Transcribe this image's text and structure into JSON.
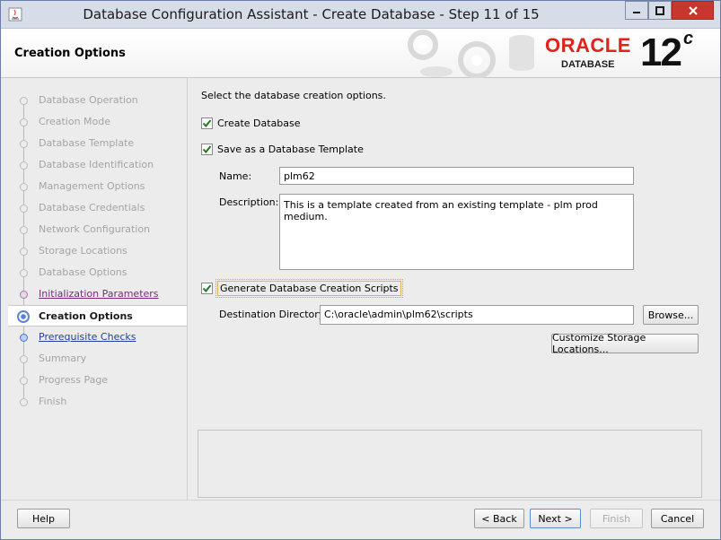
{
  "window": {
    "title": "Database Configuration Assistant - Create Database - Step 11 of 15"
  },
  "header": {
    "title": "Creation Options",
    "logo_word": "ORACLE",
    "logo_sub": "DATABASE",
    "version": "12",
    "version_sup": "c"
  },
  "nav": {
    "items": [
      {
        "label": "Database Operation",
        "state": "disabled"
      },
      {
        "label": "Creation Mode",
        "state": "disabled"
      },
      {
        "label": "Database Template",
        "state": "disabled"
      },
      {
        "label": "Database Identification",
        "state": "disabled"
      },
      {
        "label": "Management Options",
        "state": "disabled"
      },
      {
        "label": "Database Credentials",
        "state": "disabled"
      },
      {
        "label": "Network Configuration",
        "state": "disabled"
      },
      {
        "label": "Storage Locations",
        "state": "disabled"
      },
      {
        "label": "Database Options",
        "state": "disabled"
      },
      {
        "label": "Initialization Parameters",
        "state": "visited"
      },
      {
        "label": "Creation Options",
        "state": "active"
      },
      {
        "label": "Prerequisite Checks",
        "state": "link"
      },
      {
        "label": "Summary",
        "state": "disabled"
      },
      {
        "label": "Progress Page",
        "state": "disabled"
      },
      {
        "label": "Finish",
        "state": "disabled"
      }
    ]
  },
  "main": {
    "prompt": "Select the database creation options.",
    "create_db": {
      "label": "Create Database",
      "checked": true
    },
    "save_template": {
      "label": "Save as a Database Template",
      "checked": true
    },
    "name_label": "Name:",
    "name_value": "plm62",
    "description_label": "Description:",
    "description_value": "This is a template created from an existing template - plm prod medium.",
    "gen_scripts": {
      "label": "Generate Database Creation Scripts",
      "checked": true
    },
    "dest_label": "Destination Directory:",
    "dest_value": "C:\\oracle\\admin\\plm62\\scripts",
    "browse_label": "Browse...",
    "customize_label": "Customize Storage Locations..."
  },
  "buttons": {
    "help": "Help",
    "back": "< Back",
    "next": "Next >",
    "finish": "Finish",
    "cancel": "Cancel"
  },
  "colors": {
    "oracle_red": "#e2231a",
    "link_blue": "#1f3fa3",
    "visited_purple": "#7a2a7a",
    "close_red": "#c7372f"
  }
}
